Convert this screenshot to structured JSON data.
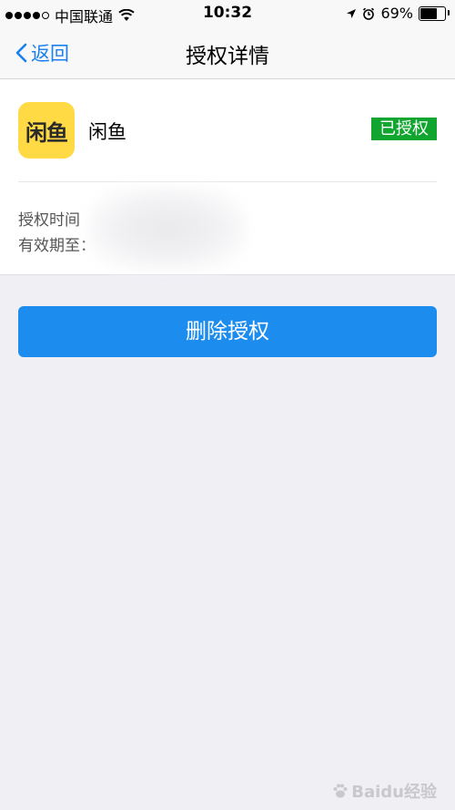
{
  "status_bar": {
    "carrier": "中国联通",
    "time": "10:32",
    "battery": "69%",
    "battery_level": 0.69,
    "icons": [
      "signal-dots",
      "wifi-icon",
      "location-icon",
      "alarm-icon",
      "battery-icon"
    ]
  },
  "nav": {
    "back_label": "返回",
    "title": "授权详情"
  },
  "app": {
    "logo_text": "闲鱼",
    "name": "闲鱼",
    "status": "已授权",
    "status_color": "#0fa52f"
  },
  "details": {
    "auth_time_label": "授权时间",
    "expiry_label": "有效期至："
  },
  "actions": {
    "delete_label": "删除授权",
    "button_color": "#1c8def"
  },
  "watermark": {
    "text": "Baidu经验"
  }
}
